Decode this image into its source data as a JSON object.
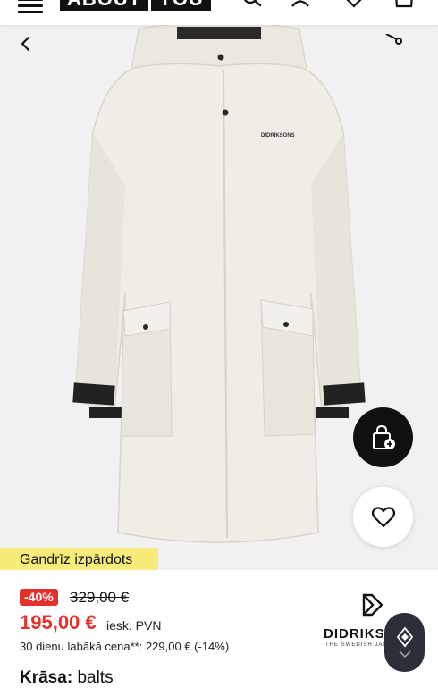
{
  "header": {
    "logo_part1": "ABOUT",
    "logo_part2": "YOU",
    "icons": [
      "menu-icon",
      "search-icon",
      "account-icon",
      "wishlist-icon",
      "bag-icon"
    ]
  },
  "gallery": {
    "product_brand_print": "DIDRIKSONS",
    "badge": "Gandrīz izpārdots",
    "dots_count": 5,
    "active_dot": 0
  },
  "pricing": {
    "discount": "-40%",
    "old_price": "329,00 €",
    "price": "195,00 €",
    "vat_note": "iesk. PVN",
    "lowest_price": "30 dienu labākā cena**: 229,00 € (-14%)"
  },
  "brand": {
    "name": "DIDRIKSONS",
    "tagline": "THE SWEDISH JACKET BRAND"
  },
  "color": {
    "label": "Krāsa:",
    "value": "balts"
  },
  "colors": {
    "accent_red": "#e4312b",
    "badge_yellow": "#f7ec79",
    "hero_bg": "#f1f1f1"
  }
}
